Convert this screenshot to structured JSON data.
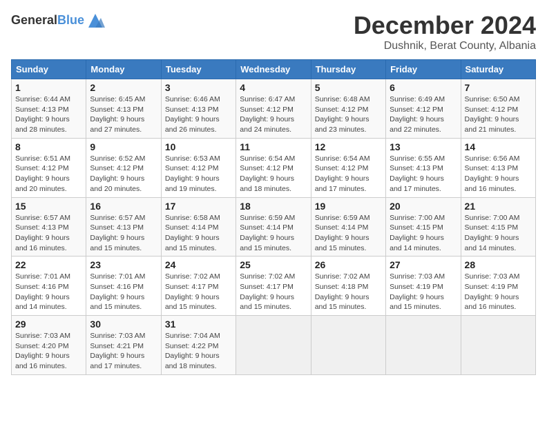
{
  "logo": {
    "text_general": "General",
    "text_blue": "Blue"
  },
  "header": {
    "month_year": "December 2024",
    "location": "Dushnik, Berat County, Albania"
  },
  "days_of_week": [
    "Sunday",
    "Monday",
    "Tuesday",
    "Wednesday",
    "Thursday",
    "Friday",
    "Saturday"
  ],
  "weeks": [
    [
      {
        "day": "1",
        "sunrise": "6:44 AM",
        "sunset": "4:13 PM",
        "daylight": "9 hours and 28 minutes."
      },
      {
        "day": "2",
        "sunrise": "6:45 AM",
        "sunset": "4:13 PM",
        "daylight": "9 hours and 27 minutes."
      },
      {
        "day": "3",
        "sunrise": "6:46 AM",
        "sunset": "4:13 PM",
        "daylight": "9 hours and 26 minutes."
      },
      {
        "day": "4",
        "sunrise": "6:47 AM",
        "sunset": "4:12 PM",
        "daylight": "9 hours and 24 minutes."
      },
      {
        "day": "5",
        "sunrise": "6:48 AM",
        "sunset": "4:12 PM",
        "daylight": "9 hours and 23 minutes."
      },
      {
        "day": "6",
        "sunrise": "6:49 AM",
        "sunset": "4:12 PM",
        "daylight": "9 hours and 22 minutes."
      },
      {
        "day": "7",
        "sunrise": "6:50 AM",
        "sunset": "4:12 PM",
        "daylight": "9 hours and 21 minutes."
      }
    ],
    [
      {
        "day": "8",
        "sunrise": "6:51 AM",
        "sunset": "4:12 PM",
        "daylight": "9 hours and 20 minutes."
      },
      {
        "day": "9",
        "sunrise": "6:52 AM",
        "sunset": "4:12 PM",
        "daylight": "9 hours and 20 minutes."
      },
      {
        "day": "10",
        "sunrise": "6:53 AM",
        "sunset": "4:12 PM",
        "daylight": "9 hours and 19 minutes."
      },
      {
        "day": "11",
        "sunrise": "6:54 AM",
        "sunset": "4:12 PM",
        "daylight": "9 hours and 18 minutes."
      },
      {
        "day": "12",
        "sunrise": "6:54 AM",
        "sunset": "4:12 PM",
        "daylight": "9 hours and 17 minutes."
      },
      {
        "day": "13",
        "sunrise": "6:55 AM",
        "sunset": "4:13 PM",
        "daylight": "9 hours and 17 minutes."
      },
      {
        "day": "14",
        "sunrise": "6:56 AM",
        "sunset": "4:13 PM",
        "daylight": "9 hours and 16 minutes."
      }
    ],
    [
      {
        "day": "15",
        "sunrise": "6:57 AM",
        "sunset": "4:13 PM",
        "daylight": "9 hours and 16 minutes."
      },
      {
        "day": "16",
        "sunrise": "6:57 AM",
        "sunset": "4:13 PM",
        "daylight": "9 hours and 15 minutes."
      },
      {
        "day": "17",
        "sunrise": "6:58 AM",
        "sunset": "4:14 PM",
        "daylight": "9 hours and 15 minutes."
      },
      {
        "day": "18",
        "sunrise": "6:59 AM",
        "sunset": "4:14 PM",
        "daylight": "9 hours and 15 minutes."
      },
      {
        "day": "19",
        "sunrise": "6:59 AM",
        "sunset": "4:14 PM",
        "daylight": "9 hours and 15 minutes."
      },
      {
        "day": "20",
        "sunrise": "7:00 AM",
        "sunset": "4:15 PM",
        "daylight": "9 hours and 14 minutes."
      },
      {
        "day": "21",
        "sunrise": "7:00 AM",
        "sunset": "4:15 PM",
        "daylight": "9 hours and 14 minutes."
      }
    ],
    [
      {
        "day": "22",
        "sunrise": "7:01 AM",
        "sunset": "4:16 PM",
        "daylight": "9 hours and 14 minutes."
      },
      {
        "day": "23",
        "sunrise": "7:01 AM",
        "sunset": "4:16 PM",
        "daylight": "9 hours and 15 minutes."
      },
      {
        "day": "24",
        "sunrise": "7:02 AM",
        "sunset": "4:17 PM",
        "daylight": "9 hours and 15 minutes."
      },
      {
        "day": "25",
        "sunrise": "7:02 AM",
        "sunset": "4:17 PM",
        "daylight": "9 hours and 15 minutes."
      },
      {
        "day": "26",
        "sunrise": "7:02 AM",
        "sunset": "4:18 PM",
        "daylight": "9 hours and 15 minutes."
      },
      {
        "day": "27",
        "sunrise": "7:03 AM",
        "sunset": "4:19 PM",
        "daylight": "9 hours and 15 minutes."
      },
      {
        "day": "28",
        "sunrise": "7:03 AM",
        "sunset": "4:19 PM",
        "daylight": "9 hours and 16 minutes."
      }
    ],
    [
      {
        "day": "29",
        "sunrise": "7:03 AM",
        "sunset": "4:20 PM",
        "daylight": "9 hours and 16 minutes."
      },
      {
        "day": "30",
        "sunrise": "7:03 AM",
        "sunset": "4:21 PM",
        "daylight": "9 hours and 17 minutes."
      },
      {
        "day": "31",
        "sunrise": "7:04 AM",
        "sunset": "4:22 PM",
        "daylight": "9 hours and 18 minutes."
      },
      null,
      null,
      null,
      null
    ]
  ],
  "labels": {
    "sunrise": "Sunrise:",
    "sunset": "Sunset:",
    "daylight": "Daylight:"
  }
}
